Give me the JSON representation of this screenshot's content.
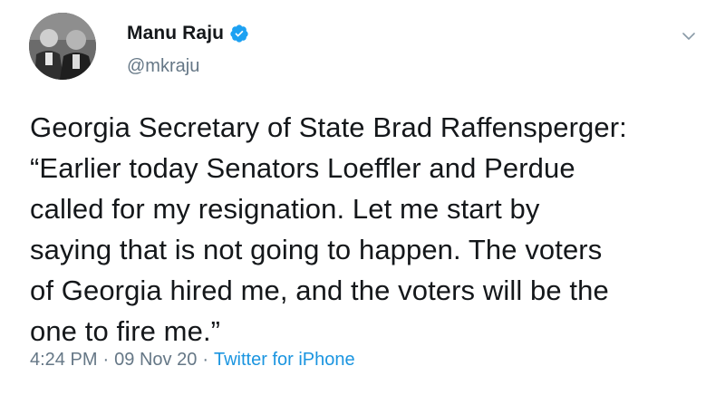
{
  "tweet": {
    "author": {
      "display_name": "Manu Raju",
      "handle": "@mkraju",
      "verified": true,
      "avatar": "profile-photo-two-people"
    },
    "text": "Georgia Secretary of State Brad Raffensperger:\n“Earlier today Senators Loeffler and Perdue\ncalled for my resignation. Let me start by\nsaying that is not going to happen. The voters\nof Georgia hired me, and the voters will be the\none to fire me.”",
    "time": "4:24 PM",
    "date": "09 Nov 20",
    "separator": "·",
    "source": "Twitter for iPhone"
  },
  "icons": {
    "verified": "verified-badge-icon",
    "menu": "chevron-down-icon"
  },
  "colors": {
    "text": "#14171a",
    "secondary": "#657786",
    "link": "#1b95e0",
    "verified": "#1da1f2"
  }
}
